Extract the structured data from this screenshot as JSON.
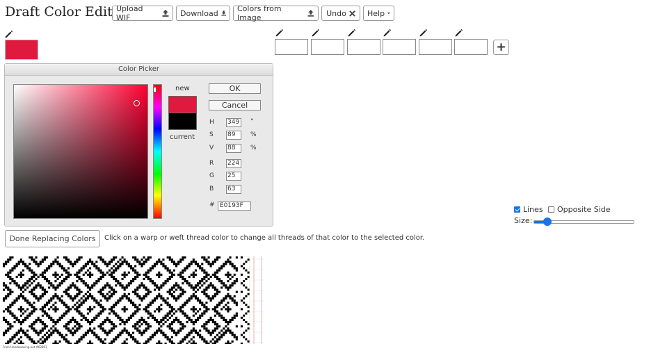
{
  "header": {
    "title": "Draft Color Editor",
    "buttons": {
      "upload_wif": "Upload WIF",
      "download": "Download",
      "colors_from_image": "Colors from Image",
      "undo": "Undo",
      "help": "Help"
    }
  },
  "palette": {
    "selected_color": "#E0193F",
    "slots": [
      "#ffffff",
      "#ffffff",
      "#ffffff",
      "#ffffff",
      "#ffffff",
      "#ffffff"
    ],
    "add_label": "+"
  },
  "picker": {
    "title": "Color Picker",
    "new_label": "new",
    "current_label": "current",
    "new_color": "#E0193F",
    "current_color": "#000000",
    "ok_label": "OK",
    "cancel_label": "Cancel",
    "h_label": "H",
    "h_value": "349",
    "h_unit": "°",
    "s_label": "S",
    "s_value": "89",
    "s_unit": "%",
    "v_label": "V",
    "v_value": "88",
    "v_unit": "%",
    "r_label": "R",
    "r_value": "224",
    "g_label": "G",
    "g_value": "25",
    "b_label": "B",
    "b_value": "63",
    "hex_label": "#",
    "hex_value": "E0193F"
  },
  "actions": {
    "done_label": "Done Replacing Colors",
    "instruction": "Click on a warp or weft thread color to change all threads of that color to the selected color."
  },
  "options": {
    "lines_label": "Lines",
    "lines_checked": true,
    "opposite_label": "Opposite Side",
    "opposite_checked": false,
    "size_label": "Size:",
    "size_value": 0.13
  },
  "footer": {
    "credit": "From Handweaving.net #62801"
  }
}
